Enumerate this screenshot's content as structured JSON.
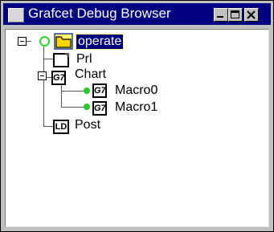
{
  "window": {
    "title": "Grafcet Debug Browser"
  },
  "tree": {
    "root": {
      "label": "operate"
    },
    "children": [
      {
        "label": "Prl",
        "badge": ""
      },
      {
        "label": "Chart",
        "badge": "G7",
        "children": [
          {
            "label": "Macro0",
            "badge": "G7"
          },
          {
            "label": "Macro1",
            "badge": "G7"
          }
        ]
      },
      {
        "label": "Post",
        "badge": "LD"
      }
    ]
  }
}
